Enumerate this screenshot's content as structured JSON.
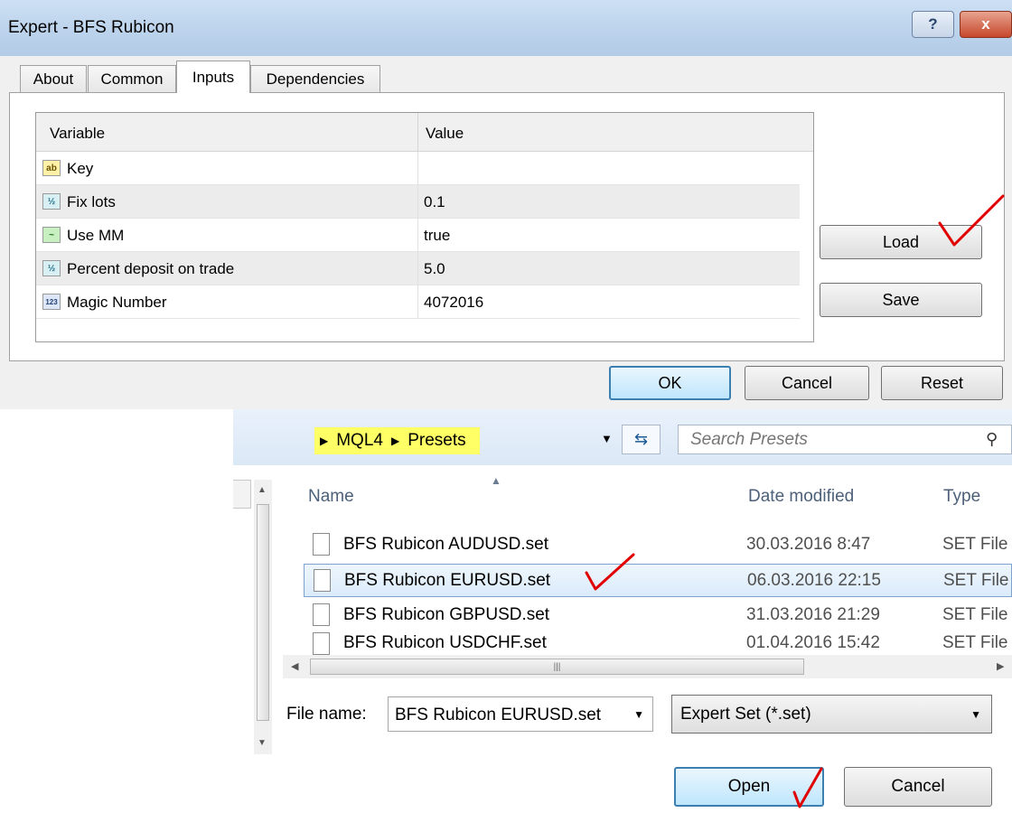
{
  "expert_dialog": {
    "title": "Expert - BFS Rubicon",
    "help_label": "?",
    "close_label": "x",
    "tabs": [
      {
        "label": "About"
      },
      {
        "label": "Common"
      },
      {
        "label": "Inputs"
      },
      {
        "label": "Dependencies"
      }
    ],
    "active_tab": "Inputs",
    "table": {
      "headers": {
        "variable": "Variable",
        "value": "Value"
      },
      "rows": [
        {
          "icon": "ab",
          "icon_name": "string-type-icon",
          "name": "Key",
          "value": ""
        },
        {
          "icon": "½",
          "icon_name": "double-type-icon",
          "name": "Fix lots",
          "value": "0.1"
        },
        {
          "icon": "~",
          "icon_name": "bool-type-icon",
          "name": "Use MM",
          "value": "true"
        },
        {
          "icon": "½",
          "icon_name": "double-type-icon",
          "name": "Percent deposit on trade",
          "value": "5.0"
        },
        {
          "icon": "123",
          "icon_name": "int-type-icon",
          "name": "Magic Number",
          "value": "4072016"
        }
      ]
    },
    "buttons": {
      "load": "Load",
      "save": "Save",
      "ok": "OK",
      "cancel": "Cancel",
      "reset": "Reset"
    }
  },
  "file_dialog": {
    "breadcrumb": [
      "MQL4",
      "Presets"
    ],
    "search_placeholder": "Search Presets",
    "columns": {
      "name": "Name",
      "date": "Date modified",
      "type": "Type"
    },
    "files": [
      {
        "name": "BFS Rubicon AUDUSD.set",
        "date": "30.03.2016 8:47",
        "type": "SET File"
      },
      {
        "name": "BFS Rubicon EURUSD.set",
        "date": "06.03.2016 22:15",
        "type": "SET File",
        "selected": true
      },
      {
        "name": "BFS Rubicon GBPUSD.set",
        "date": "31.03.2016 21:29",
        "type": "SET File"
      },
      {
        "name": "BFS Rubicon USDCHF.set",
        "date": "01.04.2016 15:42",
        "type": "SET File"
      }
    ],
    "file_name_label": "File name:",
    "file_name_value": "BFS Rubicon EURUSD.set",
    "file_type_value": "Expert Set (*.set)",
    "buttons": {
      "open": "Open",
      "cancel": "Cancel"
    }
  },
  "colors": {
    "highlight": "#ffff66",
    "annotation_red": "#e00000",
    "selection_border": "#7da2ce",
    "default_button_border": "#3c7fb1"
  }
}
